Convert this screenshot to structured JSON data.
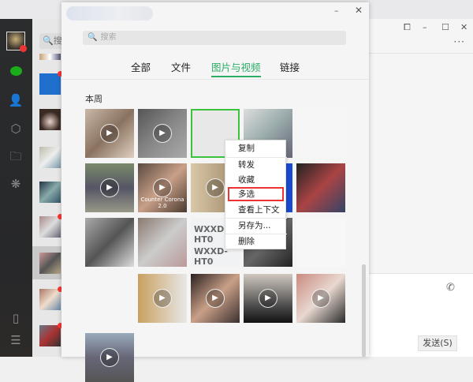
{
  "dialog": {
    "search_placeholder": "搜索",
    "tabs": [
      {
        "label": "全部"
      },
      {
        "label": "文件"
      },
      {
        "label": "图片与视频",
        "active": true
      },
      {
        "label": "链接"
      }
    ],
    "section_label": "本周",
    "minimize_icon": "minimize-icon",
    "close_icon": "close-icon"
  },
  "thumbnails": [
    {
      "type": "video",
      "caption": ""
    },
    {
      "type": "video",
      "caption": ""
    },
    {
      "type": "image",
      "caption": "",
      "selected": true
    },
    {
      "type": "image",
      "caption": ""
    },
    {
      "type": "image",
      "caption": ""
    },
    {
      "type": "video",
      "caption": ""
    },
    {
      "type": "video",
      "caption": "Counter Corona 2.0"
    },
    {
      "type": "video",
      "caption": ""
    },
    {
      "type": "image",
      "caption": ""
    },
    {
      "type": "image",
      "caption": ""
    },
    {
      "type": "image",
      "caption": ""
    },
    {
      "type": "image",
      "caption": ""
    },
    {
      "type": "image",
      "caption": "WXXD-HT0"
    },
    {
      "type": "image",
      "caption": ""
    },
    {
      "type": "image",
      "caption": ""
    },
    {
      "type": "image",
      "caption": ""
    },
    {
      "type": "video",
      "caption": ""
    },
    {
      "type": "video",
      "caption": ""
    },
    {
      "type": "video",
      "caption": ""
    },
    {
      "type": "video",
      "caption": ""
    },
    {
      "type": "video",
      "caption": ""
    }
  ],
  "context_menu": {
    "items": [
      "复制",
      "转发",
      "收藏",
      "多选",
      "查看上下文",
      "另存为...",
      "删除"
    ],
    "highlighted": "多选"
  },
  "chat_window": {
    "send_label": "发送(S)",
    "controls": [
      "pin-icon",
      "minimize-icon",
      "maximize-icon",
      "close-icon"
    ],
    "more_label": "···"
  },
  "chatlist": {
    "search_placeholder": "搜"
  },
  "colors": {
    "accent": "#2aae67",
    "highlight": "#e33333",
    "sidebar": "#2b2c2e"
  }
}
